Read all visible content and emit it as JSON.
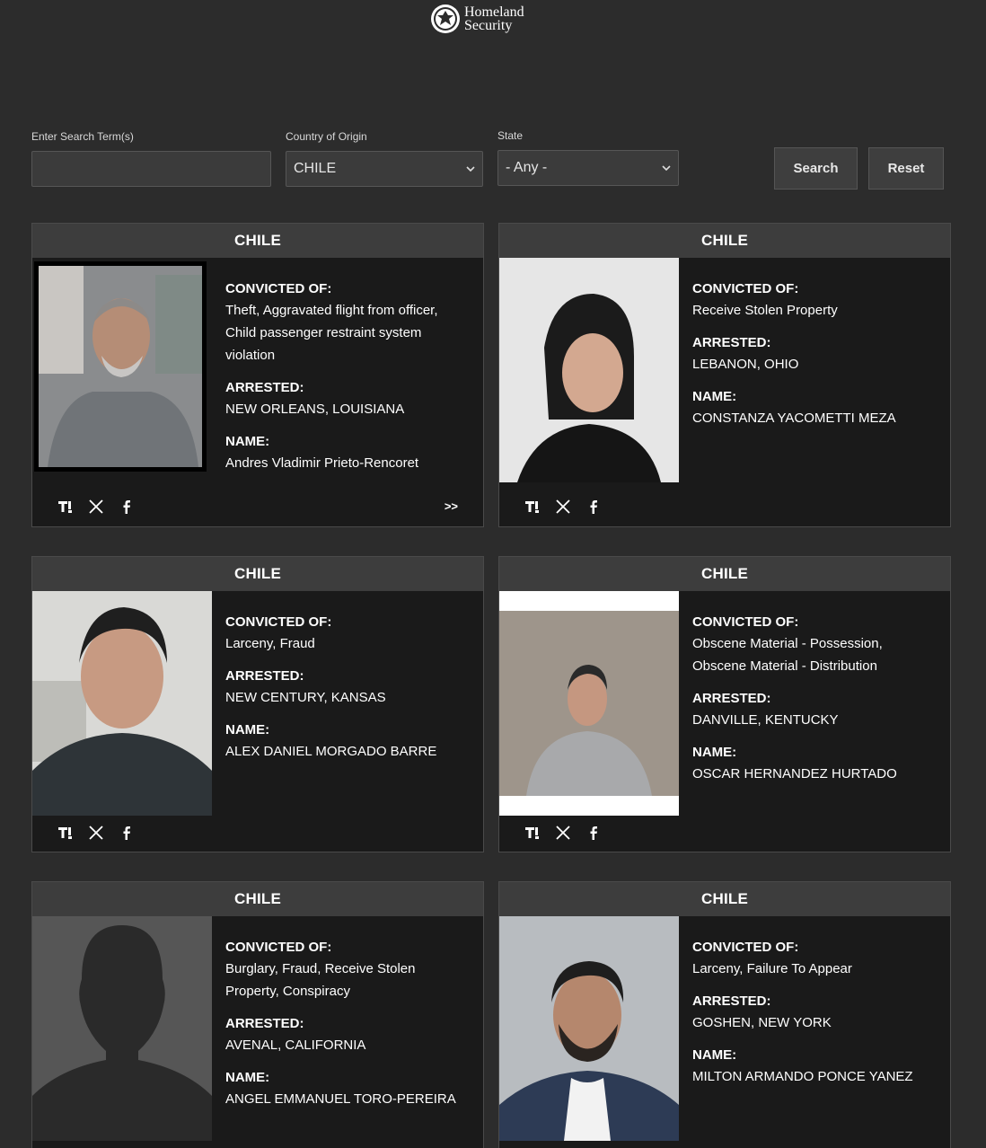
{
  "header": {
    "logo_line1": "Homeland",
    "logo_line2": "Security"
  },
  "filters": {
    "search_label": "Enter Search Term(s)",
    "search_value": "",
    "country_label": "Country of Origin",
    "country_value": "CHILE",
    "state_label": "State",
    "state_value": "- Any -",
    "search_button": "Search",
    "reset_button": "Reset"
  },
  "labels": {
    "convicted": "CONVICTED OF:",
    "arrested": "ARRESTED:",
    "name": "NAME:",
    "more": ">>"
  },
  "cards": [
    {
      "country": "CHILE",
      "convicted": "Theft, Aggravated flight from officer, Child passenger restraint system violation",
      "arrested": "NEW ORLEANS, LOUISIANA",
      "name": "Andres Vladimir Prieto-Rencoret"
    },
    {
      "country": "CHILE",
      "convicted": "Receive Stolen Property",
      "arrested": "LEBANON, OHIO",
      "name": "CONSTANZA YACOMETTI MEZA"
    },
    {
      "country": "CHILE",
      "convicted": "Larceny, Fraud",
      "arrested": "NEW CENTURY, KANSAS",
      "name": "ALEX DANIEL MORGADO BARRE"
    },
    {
      "country": "CHILE",
      "convicted": "Obscene Material - Possession, Obscene Material - Distribution",
      "arrested": "DANVILLE, KENTUCKY",
      "name": "OSCAR HERNANDEZ HURTADO"
    },
    {
      "country": "CHILE",
      "convicted": "Burglary, Fraud, Receive Stolen Property, Conspiracy",
      "arrested": "AVENAL, CALIFORNIA",
      "name": "ANGEL EMMANUEL TORO-PEREIRA"
    },
    {
      "country": "CHILE",
      "convicted": "Larceny, Failure To Appear",
      "arrested": "GOSHEN, NEW YORK",
      "name": "MILTON ARMANDO PONCE YANEZ"
    }
  ],
  "icons": {
    "truth": "truth-social-icon",
    "x": "x-icon",
    "facebook": "facebook-icon"
  }
}
